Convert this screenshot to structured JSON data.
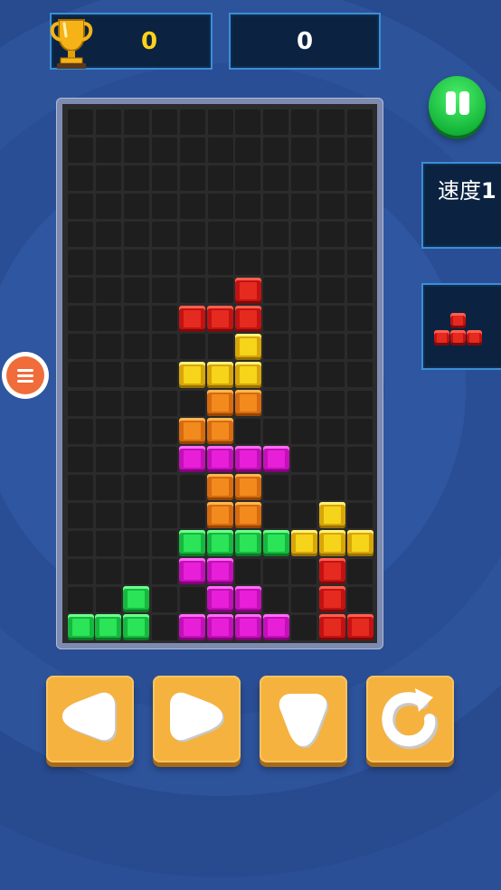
{
  "header": {
    "best_score": "0",
    "current_score": "0",
    "trophy_icon": "trophy-icon"
  },
  "side": {
    "speed_label": "速度",
    "speed_value": "1",
    "pause_icon": "pause-icon",
    "next_piece": {
      "shape": "T",
      "color": "red"
    }
  },
  "menu": {
    "icon": "hamburger-menu-icon"
  },
  "board": {
    "columns": 11,
    "rows": 19,
    "blocks": [
      {
        "r": 6,
        "c": 6,
        "color": "red"
      },
      {
        "r": 7,
        "c": 4,
        "color": "red"
      },
      {
        "r": 7,
        "c": 5,
        "color": "red"
      },
      {
        "r": 7,
        "c": 6,
        "color": "red"
      },
      {
        "r": 8,
        "c": 6,
        "color": "yellow"
      },
      {
        "r": 9,
        "c": 4,
        "color": "yellow"
      },
      {
        "r": 9,
        "c": 5,
        "color": "yellow"
      },
      {
        "r": 9,
        "c": 6,
        "color": "yellow"
      },
      {
        "r": 10,
        "c": 5,
        "color": "orange"
      },
      {
        "r": 10,
        "c": 6,
        "color": "orange"
      },
      {
        "r": 11,
        "c": 4,
        "color": "orange"
      },
      {
        "r": 11,
        "c": 5,
        "color": "orange"
      },
      {
        "r": 12,
        "c": 4,
        "color": "magenta"
      },
      {
        "r": 12,
        "c": 5,
        "color": "magenta"
      },
      {
        "r": 12,
        "c": 6,
        "color": "magenta"
      },
      {
        "r": 12,
        "c": 7,
        "color": "magenta"
      },
      {
        "r": 13,
        "c": 5,
        "color": "orange"
      },
      {
        "r": 13,
        "c": 6,
        "color": "orange"
      },
      {
        "r": 14,
        "c": 5,
        "color": "orange"
      },
      {
        "r": 14,
        "c": 6,
        "color": "orange"
      },
      {
        "r": 14,
        "c": 9,
        "color": "yellow"
      },
      {
        "r": 15,
        "c": 4,
        "color": "green"
      },
      {
        "r": 15,
        "c": 5,
        "color": "green"
      },
      {
        "r": 15,
        "c": 6,
        "color": "green"
      },
      {
        "r": 15,
        "c": 7,
        "color": "green"
      },
      {
        "r": 15,
        "c": 8,
        "color": "yellow"
      },
      {
        "r": 15,
        "c": 9,
        "color": "yellow"
      },
      {
        "r": 15,
        "c": 10,
        "color": "yellow"
      },
      {
        "r": 16,
        "c": 4,
        "color": "magenta"
      },
      {
        "r": 16,
        "c": 5,
        "color": "magenta"
      },
      {
        "r": 16,
        "c": 9,
        "color": "red"
      },
      {
        "r": 17,
        "c": 2,
        "color": "green"
      },
      {
        "r": 17,
        "c": 5,
        "color": "magenta"
      },
      {
        "r": 17,
        "c": 6,
        "color": "magenta"
      },
      {
        "r": 17,
        "c": 9,
        "color": "red"
      },
      {
        "r": 18,
        "c": 0,
        "color": "green"
      },
      {
        "r": 18,
        "c": 1,
        "color": "green"
      },
      {
        "r": 18,
        "c": 2,
        "color": "green"
      },
      {
        "r": 18,
        "c": 4,
        "color": "magenta"
      },
      {
        "r": 18,
        "c": 5,
        "color": "magenta"
      },
      {
        "r": 18,
        "c": 6,
        "color": "magenta"
      },
      {
        "r": 18,
        "c": 7,
        "color": "magenta"
      },
      {
        "r": 18,
        "c": 9,
        "color": "red"
      },
      {
        "r": 18,
        "c": 10,
        "color": "red"
      }
    ]
  },
  "controls": [
    {
      "name": "move-left-button",
      "icon": "left-arrow-icon"
    },
    {
      "name": "move-right-button",
      "icon": "right-arrow-icon"
    },
    {
      "name": "drop-down-button",
      "icon": "down-arrow-icon"
    },
    {
      "name": "rotate-button",
      "icon": "rotate-icon"
    }
  ],
  "colors": {
    "background": "#2a4e95",
    "panel": "#0b2340",
    "panel_border": "#3a8fd6",
    "best_score_text": "#ffd21a",
    "control_button": "#f5b23f",
    "pause_button": "#16b83b",
    "menu_button": "#f06c3a"
  }
}
